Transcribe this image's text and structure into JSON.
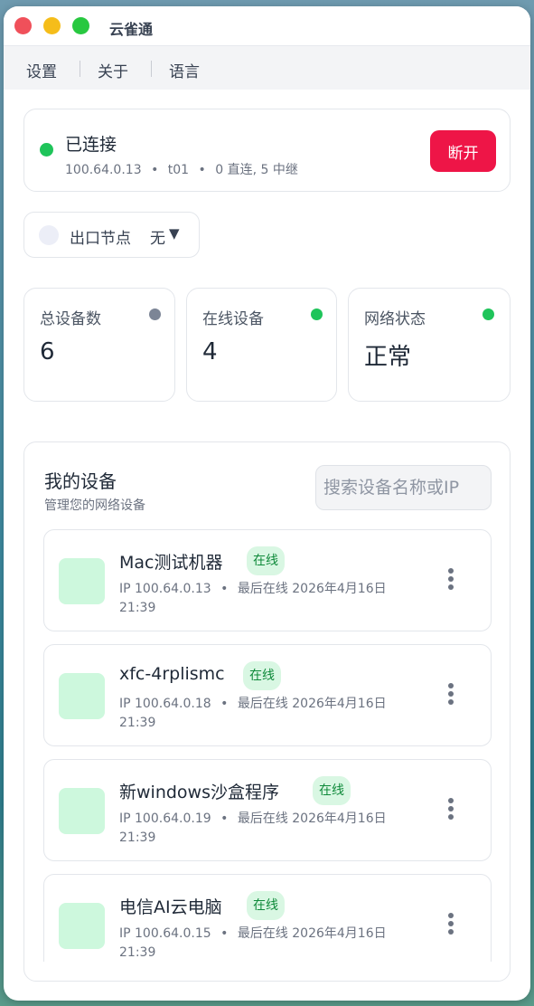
{
  "window": {
    "title": "云雀通"
  },
  "menu": {
    "settings": "设置",
    "about": "关于",
    "language": "语言"
  },
  "status": {
    "title": "已连接",
    "ip": "100.64.0.13",
    "tag": "t01",
    "links": "0 直连, 5 中继",
    "separator": "•",
    "disconnect_label": "断开"
  },
  "exit_node": {
    "label": "出口节点",
    "value": "无",
    "caret": "▼"
  },
  "stats": [
    {
      "label": "总设备数",
      "value": "6",
      "dot_color": "#7c8596"
    },
    {
      "label": "在线设备",
      "value": "4",
      "dot_color": "#1fc45a"
    },
    {
      "label": "网络状态",
      "value": "正常",
      "dot_color": "#1fc45a"
    }
  ],
  "devices_panel": {
    "title": "我的设备",
    "subtitle": "管理您的网络设备",
    "search_placeholder": "搜索设备名称或IP"
  },
  "devices": [
    {
      "name": "Mac测试机器",
      "status": "在线",
      "ip": "IP 100.64.0.13",
      "last_seen": "最后在线 2026年4月16日 21:39"
    },
    {
      "name": "xfc-4rplismc",
      "status": "在线",
      "ip": "IP 100.64.0.18",
      "last_seen": "最后在线 2026年4月16日 21:39"
    },
    {
      "name": "新windows沙盒程序",
      "status": "在线",
      "ip": "IP 100.64.0.19",
      "last_seen": "最后在线 2026年4月16日 21:39"
    },
    {
      "name": "电信AI云电脑",
      "status": "在线",
      "ip": "IP 100.64.0.15",
      "last_seen": "最后在线 2026年4月16日 21:39"
    }
  ],
  "colors": {
    "accent_red": "#ee1547",
    "online_green": "#1fc45a",
    "avatar_green": "#cdf8dd"
  }
}
